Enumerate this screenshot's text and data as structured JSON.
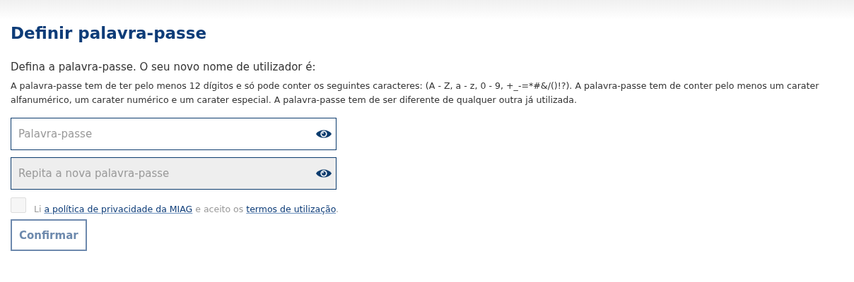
{
  "title": "Definir palavra-passe",
  "intro": "Defina a palavra-passe. O seu novo nome de utilizador é:",
  "rules": "A palavra-passe tem de ter pelo menos 12 dígitos e só pode conter os seguintes caracteres: (A - Z, a - z, 0 - 9, +_-=*#&/()!?). A palavra-passe tem de conter pelo menos um carater alfanumérico, um carater numérico e um carater especial. A palavra-passe tem de ser diferente de qualquer outra já utilizada.",
  "fields": [
    {
      "placeholder": "Palavra-passe",
      "disabled": false
    },
    {
      "placeholder": "Repita a nova palavra-passe",
      "disabled": true
    }
  ],
  "consent": {
    "checked": false,
    "disabled": true,
    "parts": [
      {
        "kind": "text",
        "text": "Li "
      },
      {
        "kind": "link",
        "text": "a política de privacidade da MIAG"
      },
      {
        "kind": "text",
        "text": " e aceito os "
      },
      {
        "kind": "link",
        "text": "termos de utilização"
      },
      {
        "kind": "text",
        "text": "."
      }
    ]
  },
  "confirm": {
    "label": "Confirmar",
    "disabled": true
  }
}
